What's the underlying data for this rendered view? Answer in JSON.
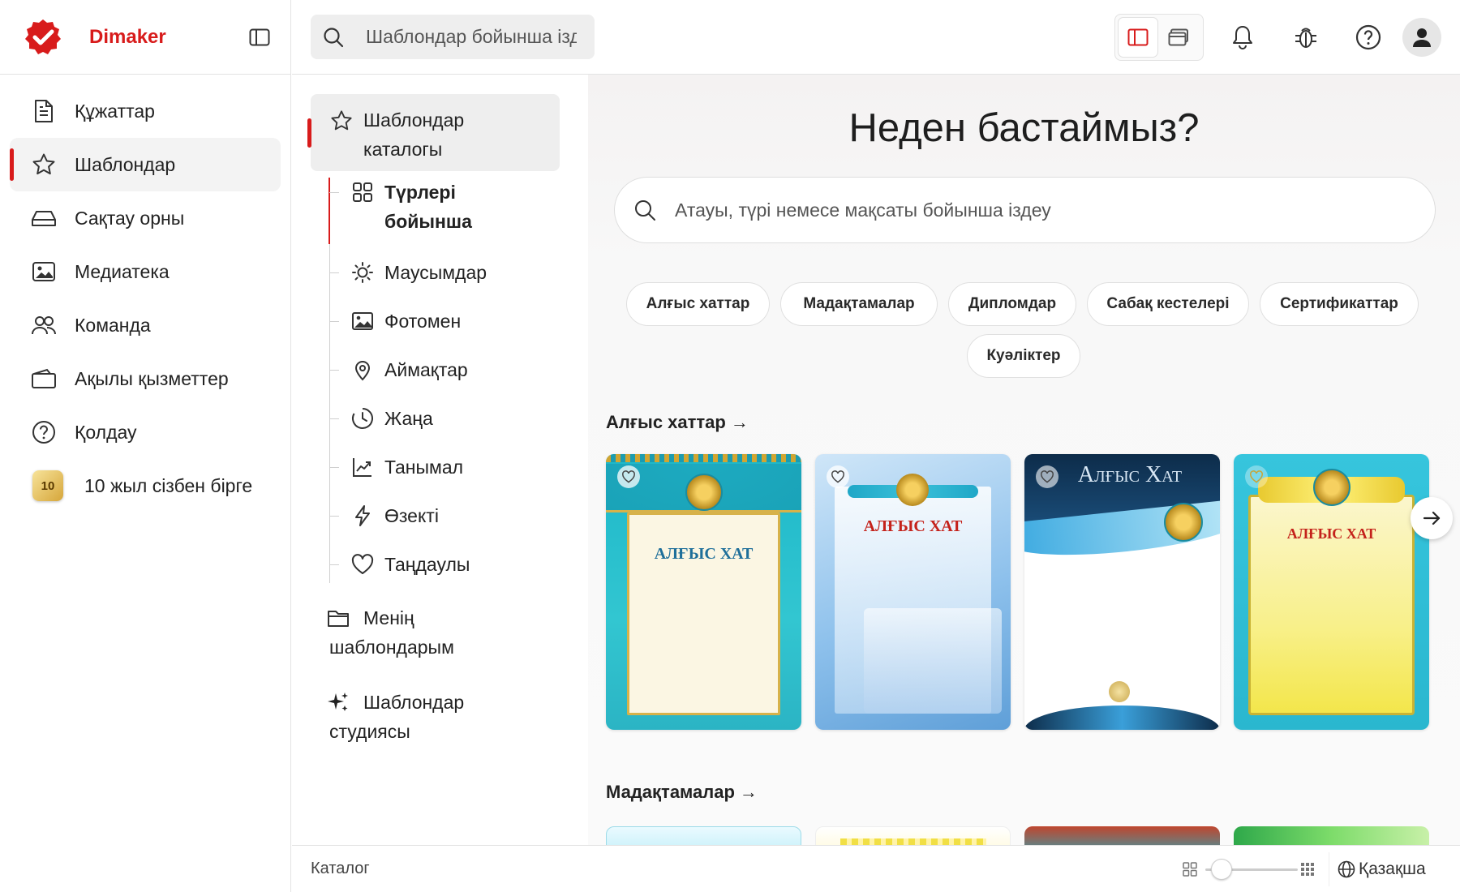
{
  "app": {
    "name": "Dimaker",
    "brand_color": "#d81b1b"
  },
  "header": {
    "search_placeholder": "Шаблондар бойынша іздеу"
  },
  "sidebar": {
    "items": [
      {
        "label": "Құжаттар",
        "icon": "document-icon"
      },
      {
        "label": "Шаблондар",
        "icon": "star-icon",
        "active": true
      },
      {
        "label": "Сақтау орны",
        "icon": "storage-drive-icon"
      },
      {
        "label": "Медиатека",
        "icon": "media-library-icon"
      },
      {
        "label": "Команда",
        "icon": "team-icon"
      },
      {
        "label": "Ақылы қызметтер",
        "icon": "wallet-icon"
      },
      {
        "label": "Қолдау",
        "icon": "help-circle-icon"
      },
      {
        "label": "10 жыл сізбен бірге",
        "badge": "10"
      }
    ]
  },
  "catalog": {
    "root_label": "Шаблондар каталогы",
    "tree": [
      {
        "label": "Түрлері бойынша",
        "icon": "grid-icon",
        "active": true
      },
      {
        "label": "Маусымдар",
        "icon": "sun-icon"
      },
      {
        "label": "Фотомен",
        "icon": "image-icon"
      },
      {
        "label": "Аймақтар",
        "icon": "location-pin-icon"
      },
      {
        "label": "Жаңа",
        "icon": "clock-icon"
      },
      {
        "label": "Танымал",
        "icon": "trending-chart-icon"
      },
      {
        "label": "Өзекті",
        "icon": "lightning-icon"
      },
      {
        "label": "Таңдаулы",
        "icon": "heart-icon"
      }
    ],
    "my_templates": "Менің шаблондарым",
    "studio": "Шаблондар студиясы"
  },
  "main": {
    "title": "Неден бастаймыз?",
    "search_placeholder": "Атауы, түрі немесе мақсаты бойынша іздеу",
    "chips": [
      "Алғыс хаттар",
      "Мадақтамалар",
      "Дипломдар",
      "Сабақ кестелері",
      "Сертификаттар",
      "Куәліктер"
    ],
    "sections": [
      {
        "title": "Алғыс хаттар",
        "cards": [
          {
            "title": "АЛҒЫС ХАТ"
          },
          {
            "title": "АЛҒЫС ХАТ"
          },
          {
            "title": "Алғыс Хат"
          },
          {
            "title": "АЛҒЫС ХАТ"
          }
        ]
      },
      {
        "title": "Мадақтамалар"
      }
    ]
  },
  "footer": {
    "label": "Каталог",
    "language": "Қазақша"
  }
}
